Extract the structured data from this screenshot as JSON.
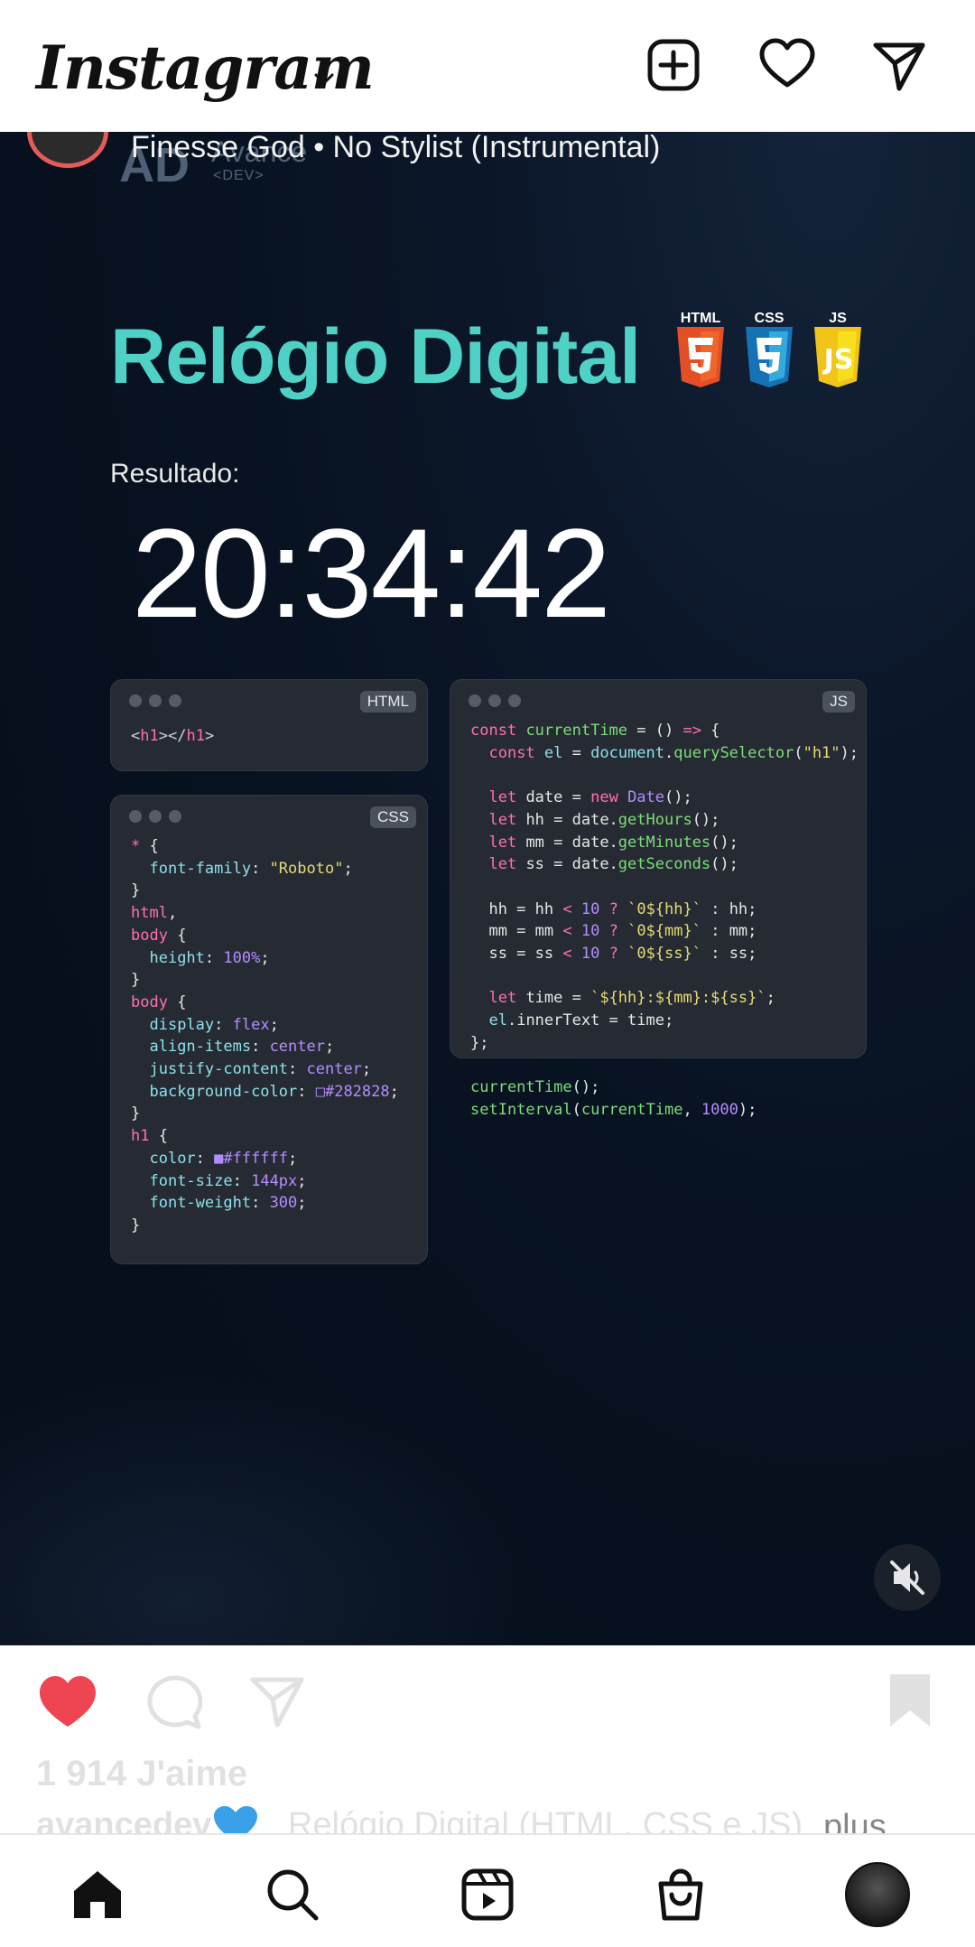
{
  "app": {
    "title": "Instagram"
  },
  "header": {
    "brand": "Instagram"
  },
  "post": {
    "audio": "Finesse God • No Stylist (Instrumental)",
    "channel": {
      "logo_text": "AD",
      "name": "Avance",
      "tag": "<DEV>"
    },
    "title": "Relógio Digital",
    "badges": [
      "HTML",
      "CSS",
      "JS"
    ],
    "result_label": "Resultado:",
    "clock_time": "20:34:42",
    "cards": {
      "html": {
        "tag": "HTML"
      },
      "css": {
        "tag": "CSS"
      },
      "js": {
        "tag": "JS"
      }
    }
  },
  "actions": {
    "likes": "1 914 J'aime",
    "caption_user": "avancedev",
    "caption_text": " Relógio Digital (HTML, CSS e JS)",
    "more_label": "plus"
  },
  "colors": {
    "accent": "#4fd1c5",
    "like": "#ef4452",
    "background": "#07111f"
  },
  "icons": {
    "top": [
      "add-post-icon",
      "heart-icon",
      "direct-message-icon"
    ],
    "nav": [
      "home-icon",
      "search-icon",
      "reels-icon",
      "shop-icon",
      "profile-avatar"
    ]
  }
}
